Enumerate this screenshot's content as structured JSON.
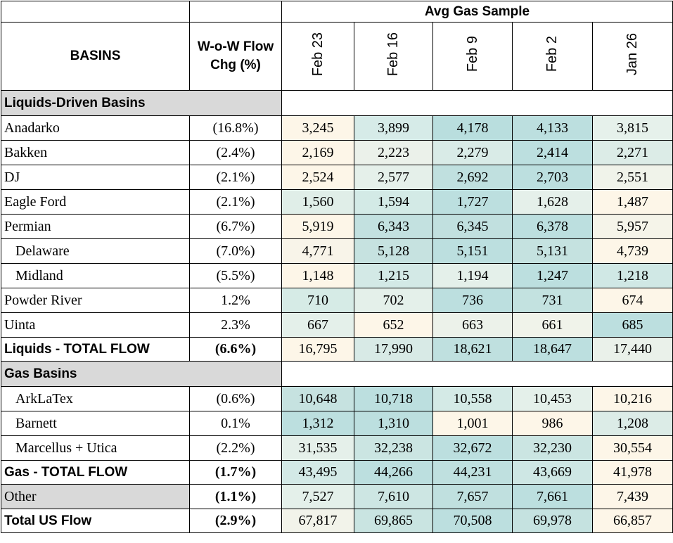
{
  "header": {
    "top_label": "Avg Gas Sample",
    "basins_label": "BASINS",
    "wow_label_line1": "W-o-W Flow",
    "wow_label_line2": "Chg (%)",
    "dates": [
      "Feb 23",
      "Feb 16",
      "Feb 9",
      "Feb 2",
      "Jan 26"
    ]
  },
  "rows": [
    {
      "type": "section",
      "name": "Liquids-Driven Basins",
      "bold": true
    },
    {
      "type": "data",
      "name": "Anadarko",
      "indent": false,
      "chg": "(16.8%)",
      "values": [
        "3,245",
        "3,899",
        "4,178",
        "4,133",
        "3,815"
      ],
      "colors": [
        "#fdf6e8",
        "#d6ebe8",
        "#b9dede",
        "#bcdfdf",
        "#e6f1eb"
      ]
    },
    {
      "type": "data",
      "name": "Bakken",
      "indent": false,
      "chg": "(2.4%)",
      "values": [
        "2,169",
        "2,223",
        "2,279",
        "2,414",
        "2,271"
      ],
      "colors": [
        "#fdf6e8",
        "#ebf1ea",
        "#d9ebe7",
        "#bcdfdf",
        "#dcece7"
      ]
    },
    {
      "type": "data",
      "name": "DJ",
      "indent": false,
      "chg": "(2.1%)",
      "values": [
        "2,524",
        "2,577",
        "2,692",
        "2,703",
        "2,551"
      ],
      "colors": [
        "#fdf6e8",
        "#e5f0ea",
        "#c0e0df",
        "#bcdfdf",
        "#f0f3ea"
      ]
    },
    {
      "type": "data",
      "name": "Eagle Ford",
      "indent": false,
      "chg": "(2.1%)",
      "values": [
        "1,560",
        "1,594",
        "1,727",
        "1,628",
        "1,487"
      ],
      "colors": [
        "#e0eee8",
        "#d3eae6",
        "#bcdfdf",
        "#e5f0ea",
        "#fdf6e8"
      ]
    },
    {
      "type": "data",
      "name": "Permian",
      "indent": false,
      "chg": "(6.7%)",
      "values": [
        "5,919",
        "6,343",
        "6,345",
        "6,378",
        "5,957"
      ],
      "colors": [
        "#fdf6e8",
        "#c3e1e0",
        "#c1e0df",
        "#bcdfdf",
        "#f5f4e9"
      ]
    },
    {
      "type": "data",
      "name": "Delaware",
      "indent": true,
      "chg": "(7.0%)",
      "values": [
        "4,771",
        "5,128",
        "5,151",
        "5,131",
        "4,739"
      ],
      "colors": [
        "#f8f4e9",
        "#c6e2e0",
        "#bcdfdf",
        "#c5e2e0",
        "#fdf6e8"
      ]
    },
    {
      "type": "data",
      "name": "Midland",
      "indent": true,
      "chg": "(5.5%)",
      "values": [
        "1,148",
        "1,215",
        "1,194",
        "1,247",
        "1,218"
      ],
      "colors": [
        "#fdf6e8",
        "#d3e9e6",
        "#e4f0ea",
        "#bcdfdf",
        "#d0e8e5"
      ]
    },
    {
      "type": "data",
      "name": "Powder River",
      "indent": false,
      "chg": "1.2%",
      "values": [
        "710",
        "702",
        "736",
        "731",
        "674"
      ],
      "colors": [
        "#d6ebe6",
        "#e4f0ea",
        "#bcdfdf",
        "#c3e2e0",
        "#fdf6e8"
      ]
    },
    {
      "type": "data",
      "name": "Uinta",
      "indent": false,
      "chg": "2.3%",
      "values": [
        "667",
        "652",
        "663",
        "661",
        "685"
      ],
      "colors": [
        "#e4f0ea",
        "#fdf6e8",
        "#ecf2ea",
        "#f0f3ea",
        "#bcdfdf"
      ]
    },
    {
      "type": "total",
      "name": "Liquids - TOTAL FLOW",
      "chg": "(6.6%)",
      "values": [
        "16,795",
        "17,990",
        "18,621",
        "18,647",
        "17,440"
      ],
      "colors": [
        "#fdf6e8",
        "#d8eae6",
        "#bfe0df",
        "#bcdfdf",
        "#eaf1ea"
      ]
    },
    {
      "type": "section",
      "name": "Gas Basins",
      "bold": true
    },
    {
      "type": "data",
      "name": "ArkLaTex",
      "indent": true,
      "chg": "(0.6%)",
      "values": [
        "10,648",
        "10,718",
        "10,558",
        "10,453",
        "10,216"
      ],
      "colors": [
        "#c6e2e0",
        "#bcdfdf",
        "#d4eae6",
        "#e4f0ea",
        "#fdf6e8"
      ]
    },
    {
      "type": "data",
      "name": "Barnett",
      "indent": true,
      "chg": "0.1%",
      "values": [
        "1,312",
        "1,310",
        "1,001",
        "986",
        "1,208"
      ],
      "colors": [
        "#bcdfdf",
        "#bcdfdf",
        "#fdf6e8",
        "#fdf6e8",
        "#dcece7"
      ]
    },
    {
      "type": "data",
      "name": "Marcellus + Utica",
      "indent": true,
      "chg": "(2.2%)",
      "values": [
        "31,535",
        "32,238",
        "32,672",
        "32,230",
        "30,554"
      ],
      "colors": [
        "#e5f0ea",
        "#cbe5e2",
        "#bcdfdf",
        "#cbe5e2",
        "#fdf6e8"
      ]
    },
    {
      "type": "total",
      "name": "Gas - TOTAL FLOW",
      "chg": "(1.7%)",
      "values": [
        "43,495",
        "44,266",
        "44,231",
        "43,669",
        "41,978"
      ],
      "colors": [
        "#d3e9e6",
        "#bcdfdf",
        "#bfe0df",
        "#cee7e4",
        "#fdf6e8"
      ]
    },
    {
      "type": "other",
      "name": "Other",
      "chg": "(1.1%)",
      "values": [
        "7,527",
        "7,610",
        "7,657",
        "7,661",
        "7,439"
      ],
      "colors": [
        "#e4f0ea",
        "#cde6e3",
        "#c0e0df",
        "#bcdfdf",
        "#fdf6e8"
      ]
    },
    {
      "type": "total",
      "name": "Total US Flow",
      "chg": "(2.9%)",
      "values": [
        "67,817",
        "69,865",
        "70,508",
        "69,978",
        "66,857"
      ],
      "colors": [
        "#f2f3ea",
        "#c9e4e1",
        "#bcdfdf",
        "#c5e2e0",
        "#fdf6e8"
      ]
    }
  ]
}
